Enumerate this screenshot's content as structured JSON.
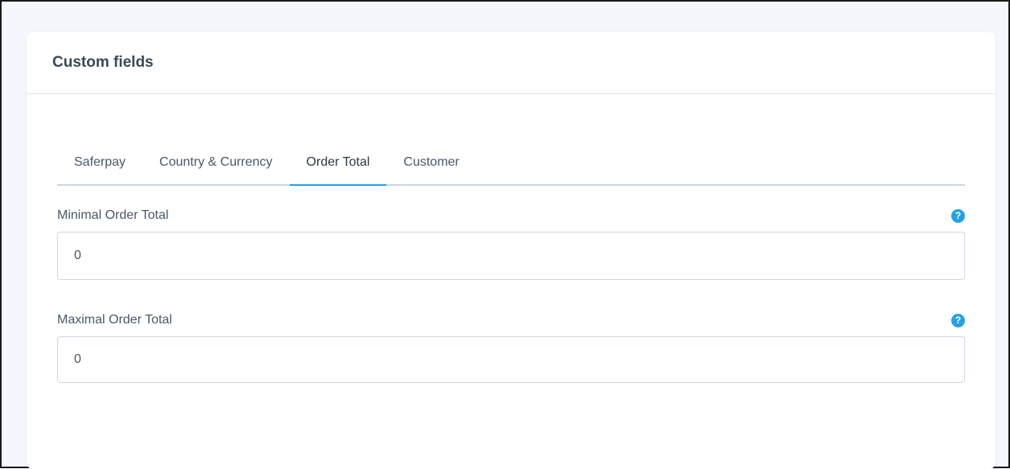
{
  "card": {
    "title": "Custom fields"
  },
  "tabs": [
    {
      "label": "Saferpay",
      "active": false
    },
    {
      "label": "Country & Currency",
      "active": false
    },
    {
      "label": "Order Total",
      "active": true
    },
    {
      "label": "Customer",
      "active": false
    }
  ],
  "fields": {
    "minimal": {
      "label": "Minimal Order Total",
      "value": "0",
      "help_icon": "question-mark-icon"
    },
    "maximal": {
      "label": "Maximal Order Total",
      "value": "0",
      "help_icon": "question-mark-icon"
    }
  },
  "colors": {
    "accent": "#25a0e6",
    "title": "#3b4858",
    "text": "#4a5868",
    "border": "#cfd8e2",
    "background": "#f4f7fb"
  }
}
